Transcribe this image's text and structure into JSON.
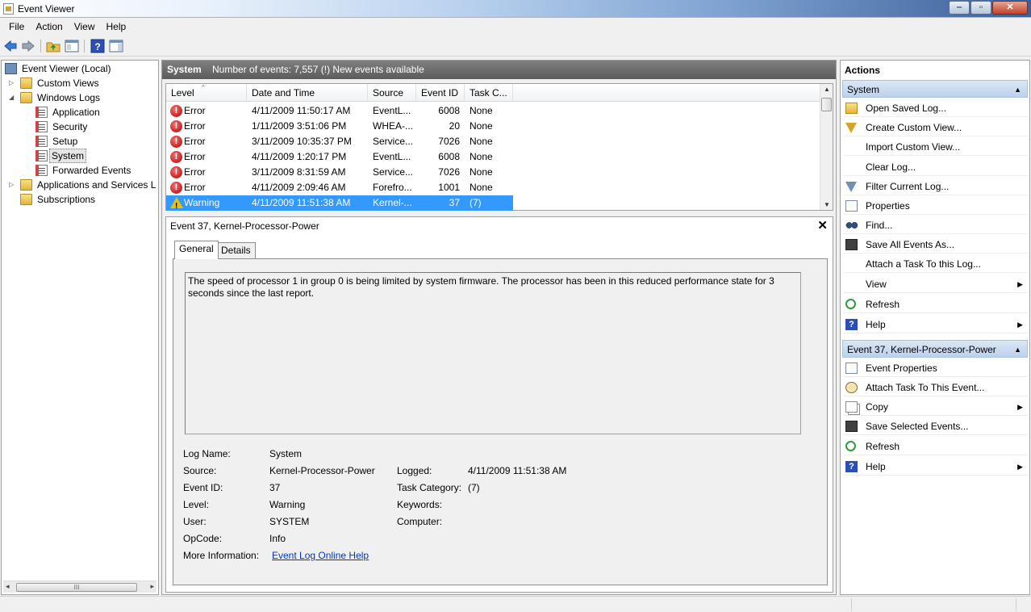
{
  "window": {
    "title": "Event Viewer",
    "controls": {
      "minimize": "‒",
      "maximize": "▫",
      "close": "✕"
    }
  },
  "menu": [
    "File",
    "Action",
    "View",
    "Help"
  ],
  "toolbar": {
    "buttons": [
      "back-arrow-icon",
      "forward-arrow-icon",
      "folder-up-icon",
      "properties-pane-icon",
      "help-icon",
      "show-hide-pane-icon"
    ]
  },
  "tree": {
    "items": [
      {
        "label": "Event Viewer (Local)",
        "icon": "computer-icon",
        "expander": ""
      },
      {
        "label": "Custom Views",
        "icon": "folder-icon",
        "expander": "▷"
      },
      {
        "label": "Windows Logs",
        "icon": "folder-icon",
        "expander": "◢"
      },
      {
        "label": "Application",
        "icon": "log-icon",
        "expander": ""
      },
      {
        "label": "Security",
        "icon": "log-icon",
        "expander": ""
      },
      {
        "label": "Setup",
        "icon": "log-icon",
        "expander": ""
      },
      {
        "label": "System",
        "icon": "log-icon",
        "expander": ""
      },
      {
        "label": "Forwarded Events",
        "icon": "log-icon",
        "expander": ""
      },
      {
        "label": "Applications and Services Lo",
        "icon": "folder-icon",
        "expander": "▷"
      },
      {
        "label": "Subscriptions",
        "icon": "folder-icon",
        "expander": ""
      }
    ],
    "selected": "System",
    "scrollbar": {
      "left": "◂",
      "right": "▸",
      "grip": "III"
    }
  },
  "center": {
    "log_name": "System",
    "event_count": "Number of events: 7,557 (!) New events available"
  },
  "grid": {
    "columns": [
      "Level",
      "Date and Time",
      "Source",
      "Event ID",
      "Task C..."
    ],
    "sort_indicator": "^",
    "rows": [
      {
        "level": "Error",
        "datetime": "4/11/2009 11:50:17 AM",
        "source": "EventL...",
        "event_id": "6008",
        "task": "None"
      },
      {
        "level": "Error",
        "datetime": "1/11/2009 3:51:06 PM",
        "source": "WHEA-...",
        "event_id": "20",
        "task": "None"
      },
      {
        "level": "Error",
        "datetime": "3/11/2009 10:35:37 PM",
        "source": "Service...",
        "event_id": "7026",
        "task": "None"
      },
      {
        "level": "Error",
        "datetime": "4/11/2009 1:20:17 PM",
        "source": "EventL...",
        "event_id": "6008",
        "task": "None"
      },
      {
        "level": "Error",
        "datetime": "3/11/2009 8:31:59 AM",
        "source": "Service...",
        "event_id": "7026",
        "task": "None"
      },
      {
        "level": "Error",
        "datetime": "4/11/2009 2:09:46 AM",
        "source": "Forefro...",
        "event_id": "1001",
        "task": "None"
      },
      {
        "level": "Warning",
        "datetime": "4/11/2009 11:51:38 AM",
        "source": "Kernel-...",
        "event_id": "37",
        "task": "(7)"
      }
    ],
    "selected_row": 6,
    "scroll": {
      "up": "▲",
      "down": "▼"
    }
  },
  "detail": {
    "title": "Event 37, Kernel-Processor-Power",
    "close": "✕",
    "tabs": [
      "General",
      "Details"
    ],
    "active_tab": "General",
    "description": "The speed of processor 1 in group 0 is being limited by system firmware. The processor has been in this reduced performance state for 3 seconds since the last report.",
    "fields": {
      "log_name_label": "Log Name:",
      "log_name": "System",
      "source_label": "Source:",
      "source": "Kernel-Processor-Power",
      "logged_label": "Logged:",
      "logged": "4/11/2009 11:51:38 AM",
      "event_id_label": "Event ID:",
      "event_id": "37",
      "task_category_label": "Task Category:",
      "task_category": "(7)",
      "level_label": "Level:",
      "level": "Warning",
      "keywords_label": "Keywords:",
      "keywords": "",
      "user_label": "User:",
      "user": "SYSTEM",
      "computer_label": "Computer:",
      "computer": "",
      "opcode_label": "OpCode:",
      "opcode": "Info",
      "more_info_label": "More Information:",
      "more_info_link": "Event Log Online Help"
    }
  },
  "actions": {
    "title": "Actions",
    "sections": [
      {
        "header": "System",
        "collapse": "▲",
        "items": [
          {
            "label": "Open Saved Log...",
            "icon": "open-folder-icon",
            "submenu": ""
          },
          {
            "label": "Create Custom View...",
            "icon": "filter-icon",
            "submenu": ""
          },
          {
            "label": "Import Custom View...",
            "icon": "",
            "submenu": ""
          },
          {
            "label": "Clear Log...",
            "icon": "",
            "submenu": ""
          },
          {
            "label": "Filter Current Log...",
            "icon": "filter-icon",
            "submenu": ""
          },
          {
            "label": "Properties",
            "icon": "properties-icon",
            "submenu": ""
          },
          {
            "label": "Find...",
            "icon": "binoculars-icon",
            "submenu": ""
          },
          {
            "label": "Save All Events As...",
            "icon": "save-icon",
            "submenu": ""
          },
          {
            "label": "Attach a Task To this Log...",
            "icon": "",
            "submenu": ""
          },
          {
            "label": "View",
            "icon": "",
            "submenu": "▶"
          },
          {
            "label": "Refresh",
            "icon": "refresh-icon",
            "submenu": ""
          },
          {
            "label": "Help",
            "icon": "help-icon",
            "submenu": "▶"
          }
        ]
      },
      {
        "header": "Event 37, Kernel-Processor-Power",
        "collapse": "▲",
        "items": [
          {
            "label": "Event Properties",
            "icon": "properties-icon",
            "submenu": ""
          },
          {
            "label": "Attach Task To This Event...",
            "icon": "task-clock-icon",
            "submenu": ""
          },
          {
            "label": "Copy",
            "icon": "copy-icon",
            "submenu": "▶"
          },
          {
            "label": "Save Selected Events...",
            "icon": "save-icon",
            "submenu": ""
          },
          {
            "label": "Refresh",
            "icon": "refresh-icon",
            "submenu": ""
          },
          {
            "label": "Help",
            "icon": "help-icon",
            "submenu": "▶"
          }
        ]
      }
    ]
  },
  "colors": {
    "selection": "#3399ff",
    "header_dark": "#6b6b6b",
    "section_header": "#c9dbf1",
    "link": "#0033cc",
    "error": "#c00000",
    "warning": "#e8c200"
  }
}
